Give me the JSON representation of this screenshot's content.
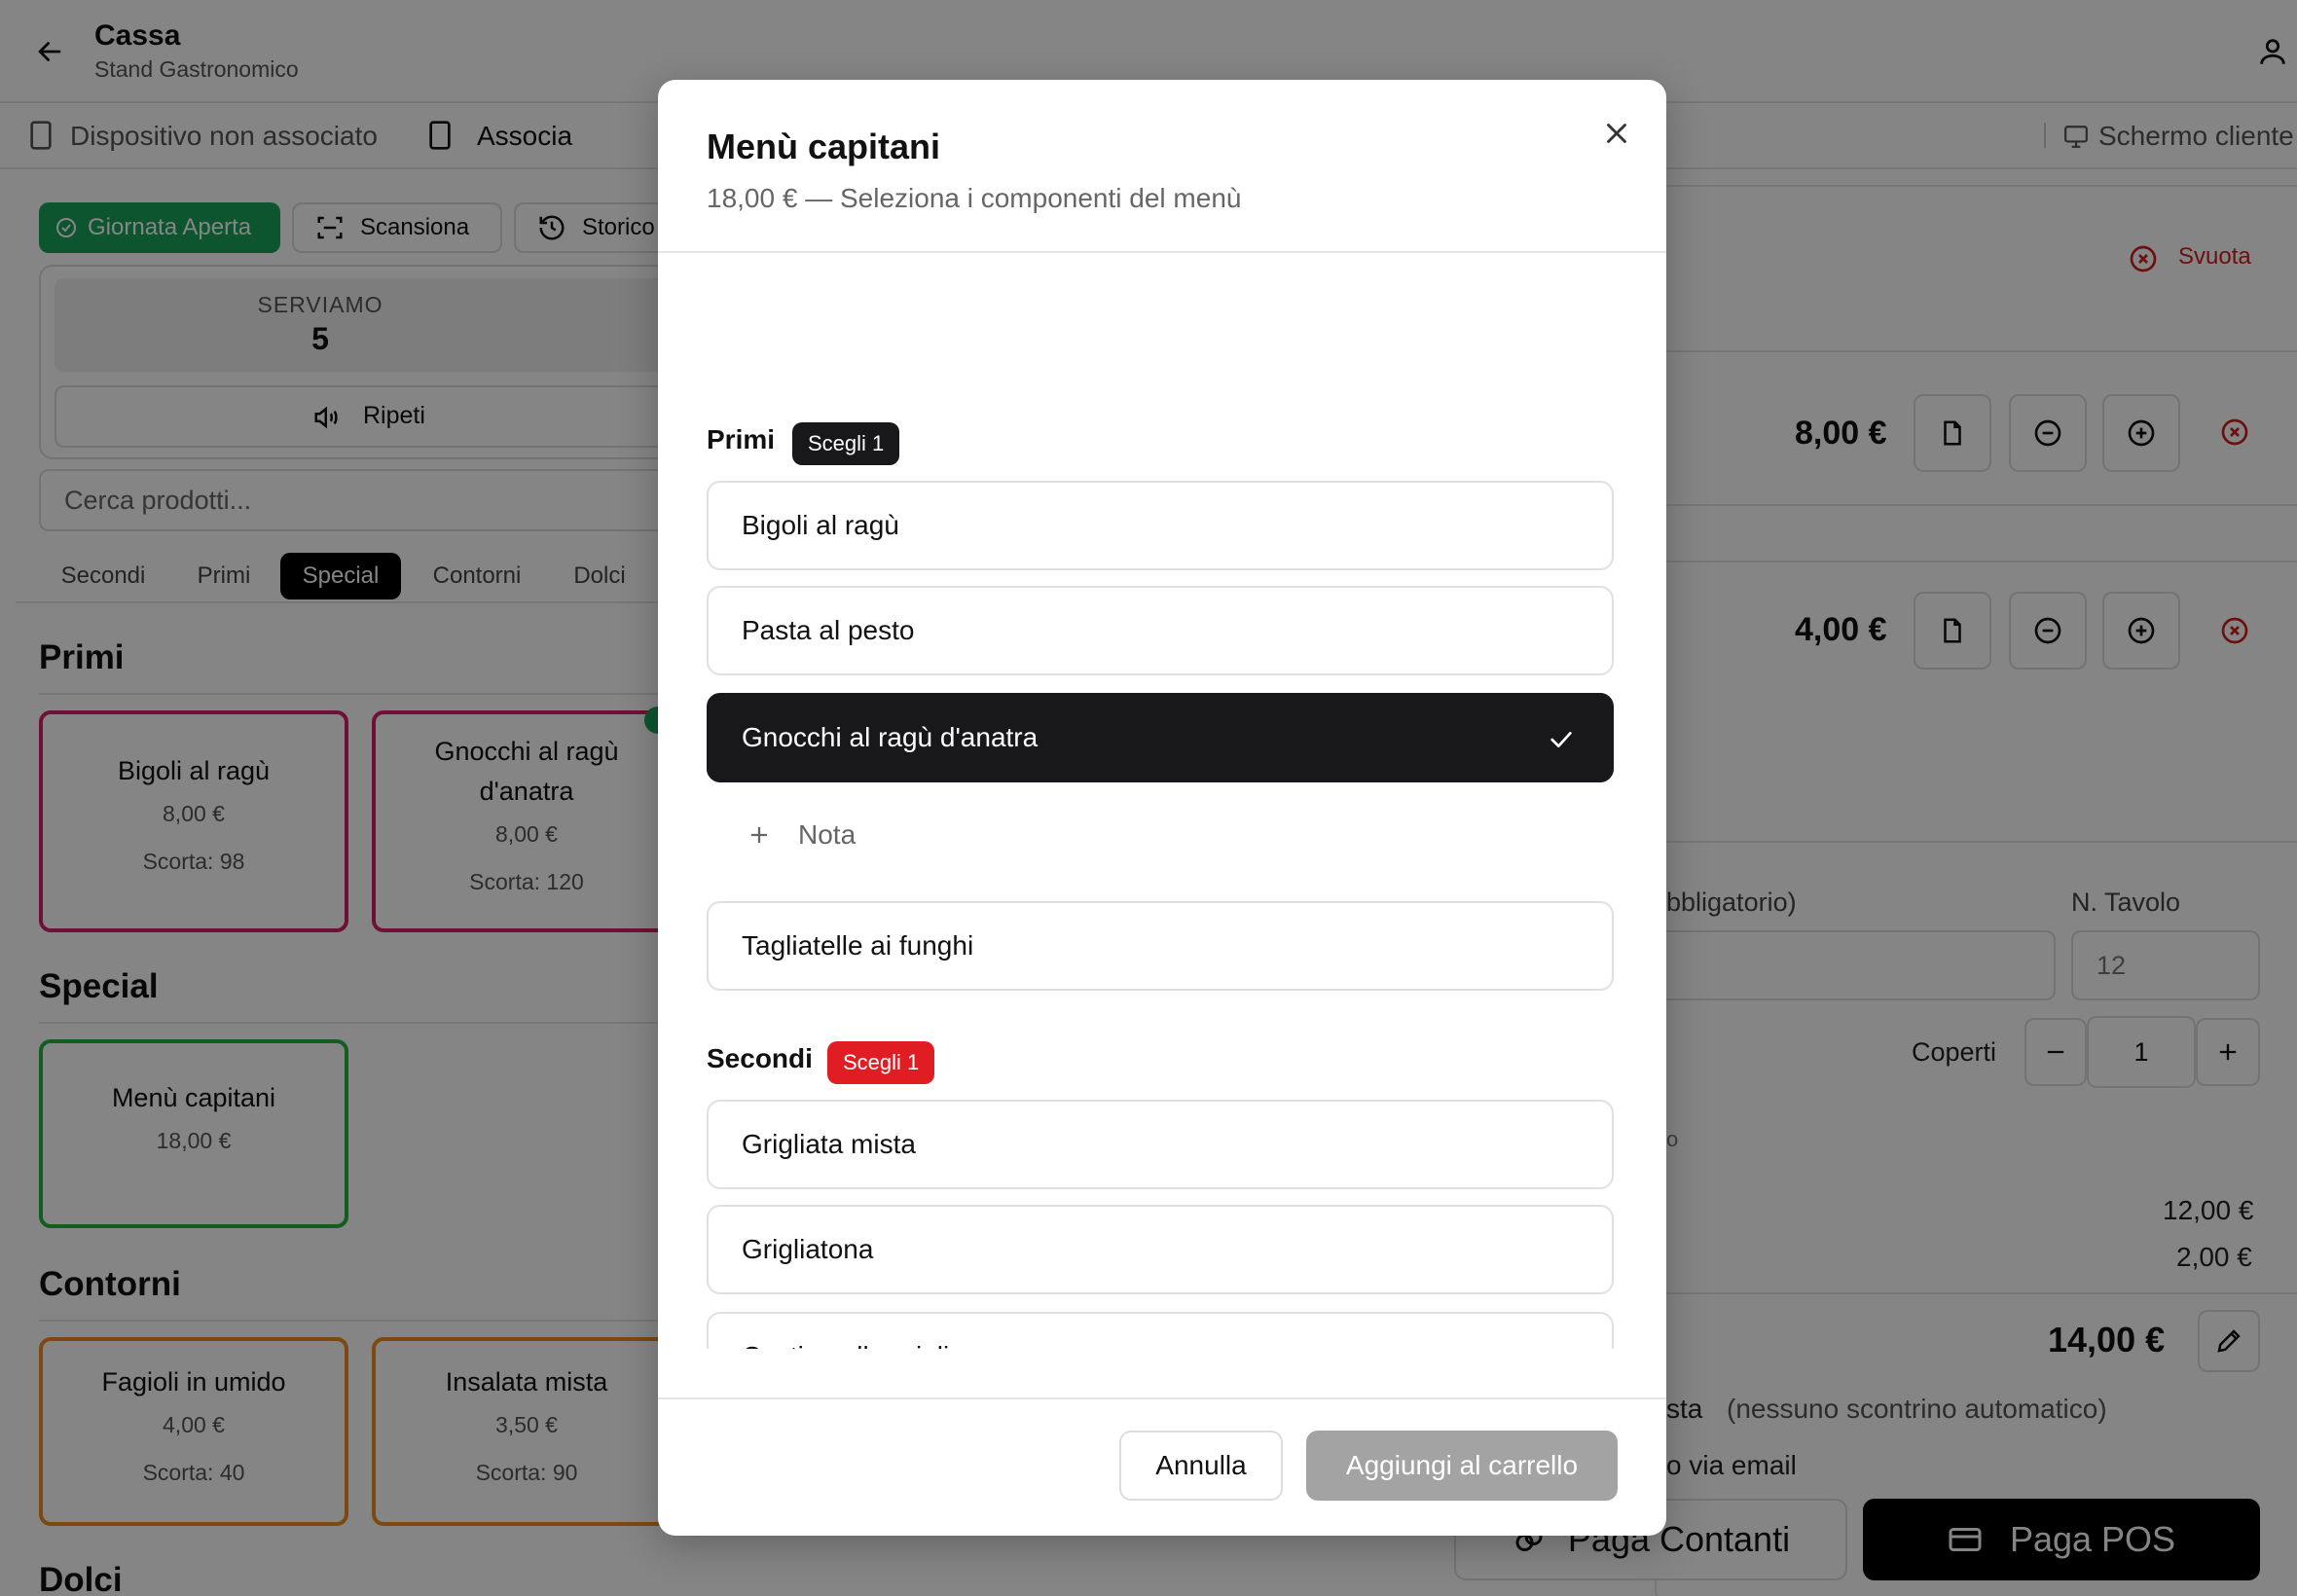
{
  "header": {
    "title": "Cassa",
    "subtitle": "Stand Gastronomico"
  },
  "device_bar": {
    "status": "Dispositivo non associato",
    "associate_label": "Associa",
    "customer_screen_label": "Schermo cliente"
  },
  "toolbar": {
    "day_open_label": "Giornata Aperta",
    "scan_label": "Scansiona",
    "history_label": "Storico"
  },
  "serving": {
    "label": "SERVIAMO",
    "number": "5",
    "repeat_label": "Ripeti"
  },
  "search": {
    "placeholder": "Cerca prodotti..."
  },
  "category_tabs": [
    "Secondi",
    "Primi",
    "Special",
    "Contorni",
    "Dolci"
  ],
  "active_tab": "Special",
  "sections": {
    "primi": {
      "title": "Primi",
      "products": [
        {
          "name": "Bigoli al ragù",
          "price": "8,00 €",
          "stock": "Scorta: 98"
        },
        {
          "name_line1": "Gnocchi al ragù",
          "name_line2": "d'anatra",
          "price": "8,00 €",
          "stock": "Scorta: 120"
        }
      ]
    },
    "special": {
      "title": "Special",
      "products": [
        {
          "name": "Menù capitani",
          "price": "18,00 €"
        }
      ]
    },
    "contorni": {
      "title": "Contorni",
      "products": [
        {
          "name": "Fagioli in umido",
          "price": "4,00 €",
          "stock": "Scorta: 40"
        },
        {
          "name": "Insalata mista",
          "price": "3,50 €",
          "stock": "Scorta: 90"
        }
      ]
    },
    "dolci": {
      "title": "Dolci"
    }
  },
  "cart": {
    "clear_label": "Svuota",
    "items": [
      {
        "price": "8,00 €"
      },
      {
        "price": "4,00 €"
      }
    ],
    "customer_label_partial": "bbligatorio)",
    "table_label": "N. Tavolo",
    "table_value": "12",
    "covers_label": "Coperti",
    "covers_value": "1",
    "partial_o": "o",
    "subtotal_1": "12,00 €",
    "subtotal_2": "2,00 €",
    "total": "14,00 €",
    "receipt_partial": "sta",
    "receipt_note": "(nessuno scontrino automatico)",
    "email_partial": "o via email",
    "pay_cash_label": "Paga Contanti",
    "pay_pos_label": "Paga POS"
  },
  "modal": {
    "title": "Menù capitani",
    "subtitle": "18,00 € — Seleziona i componenti del menù",
    "groups": [
      {
        "label": "Primi",
        "badge": "Scegli 1",
        "badge_color": "#18181b",
        "options": [
          "Bigoli al ragù",
          "Pasta al pesto",
          "Gnocchi al ragù d'anatra",
          "Tagliatelle ai funghi"
        ],
        "selected": "Gnocchi al ragù d'anatra"
      },
      {
        "label": "Secondi",
        "badge": "Scegli 1",
        "badge_color": "#e11d24",
        "options": [
          "Grigliata mista",
          "Grigliatona",
          "Costine alla griglia"
        ]
      }
    ],
    "note_label": "Nota",
    "cancel_label": "Annulla",
    "add_label": "Aggiungi al carrello"
  },
  "colors": {
    "accent_green": "#19a35a",
    "primi_border": "#d61f69",
    "special_border": "#22b43c",
    "contorni_border": "#f08a24",
    "danger": "#d21e1e"
  }
}
